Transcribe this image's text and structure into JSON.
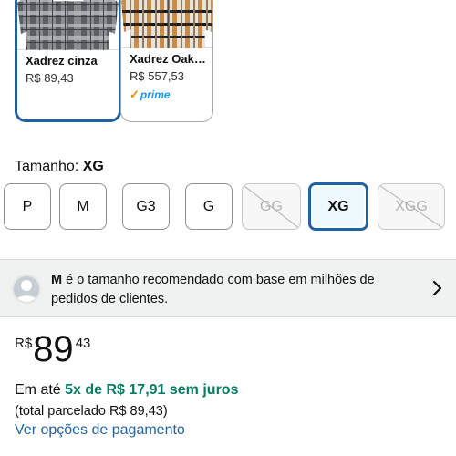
{
  "swatches": [
    {
      "name": "Xadrez cinza",
      "price": "R$ 89,43",
      "selected": true,
      "colors": [
        "#5c5f63",
        "#8a8d90",
        "#b9bcbe",
        "#3e4145"
      ]
    },
    {
      "name": "Xadrez Oak…",
      "price": "R$ 557,53",
      "prime": "prime",
      "selected": false,
      "colors": [
        "#e9e2d6",
        "#c98b4a",
        "#2a2623",
        "#8d7a66"
      ]
    }
  ],
  "size": {
    "heading_label": "Tamanho:",
    "heading_value": "XG",
    "options": [
      {
        "label": "P",
        "available": true
      },
      {
        "label": "M",
        "available": true
      },
      {
        "label": "G3",
        "available": true
      },
      {
        "label": "G",
        "available": true
      },
      {
        "label": "GG",
        "available": false
      },
      {
        "label": "XG",
        "available": true,
        "selected": true
      },
      {
        "label": "XGG",
        "available": false
      }
    ]
  },
  "recommendation": {
    "size": "M",
    "text": " é o tamanho recomendado com base em milhões de pedidos de clientes."
  },
  "price": {
    "currency": "R$",
    "whole": "89",
    "fraction": "43"
  },
  "installment": {
    "prefix": "Em até",
    "highlight": "5x de R$ 17,91 sem juros",
    "total": "(total parcelado R$ 89,43)",
    "link": "Ver opções de pagamento"
  },
  "colors": {
    "accent": "#2162a1",
    "green": "#067d62",
    "prime_blue": "#1a98ff",
    "prime_check": "#f08a00"
  }
}
